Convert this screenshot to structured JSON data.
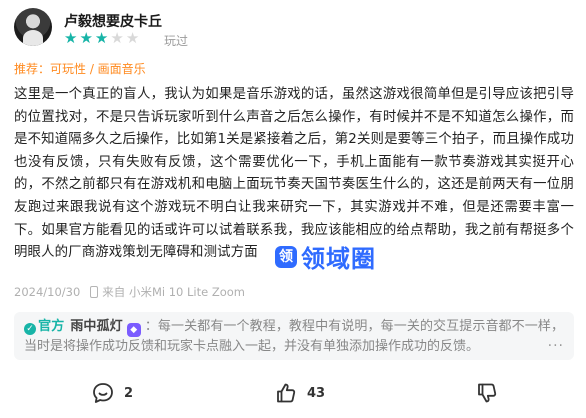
{
  "user": {
    "name": "卢毅想要皮卡丘",
    "rating": 3,
    "max_rating": 5,
    "played_label": "玩过"
  },
  "recommend": "推荐：可玩性 / 画面音乐",
  "review": {
    "body": "这里是一个真正的盲人，我认为如果是音乐游戏的话，虽然这游戏很简单但是引导应该把引导的位置找对，不是只告诉玩家听到什么声音之后怎么操作，有时候并不是不知道怎么操作，而是不知道隔多久之后操作，比如第1关是紧接着之后，第2关则是要等三个拍子，而且操作成功也没有反馈，只有失败有反馈，这个需要优化一下，手机上面能有一款节奏游戏其实挺开心的，不然之前都只有在游戏机和电脑上面玩节奏天国节奏医生什么的，这还是前两天有一位朋友跑过来跟我说有这个游戏玩不明白让我来研究一下，其实游戏并不难，但是还需要丰富一下。如果官方能看见的话或许可以试着联系我，我应该能相应的给点帮助，我之前有帮挺多个明眼人的厂商游戏策划无障碍和测试方面"
  },
  "watermark": {
    "icon": "领",
    "text": "领域圈"
  },
  "meta": {
    "date": "2024/10/30",
    "device": "来自 小米Mi 10 Lite Zoom"
  },
  "reply": {
    "official_label": "官方",
    "name": "雨中孤灯",
    "badge_icon": "gamepad-badge",
    "text": "每一关都有一个教程，教程中有说明，每一关的交互提示音都不一样，当时是将操作成功反馈和玩家卡点融入一起，并没有单独添加操作成功的反馈。",
    "more": "···"
  },
  "actions": {
    "comments": "2",
    "likes": "43",
    "dislike": ""
  },
  "colors": {
    "accent": "#17b4a7",
    "recommend": "#ff8a1f",
    "watermark": "#2f6bff"
  }
}
